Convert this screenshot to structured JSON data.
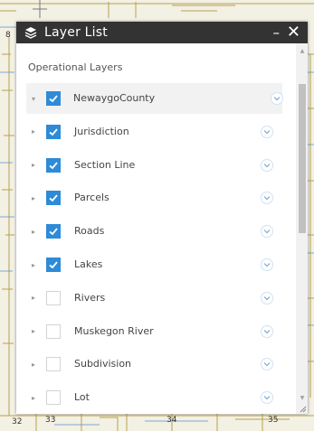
{
  "window": {
    "title": "Layer List",
    "minimize_glyph": "–",
    "close_glyph": "✕",
    "icon": "layers-icon"
  },
  "section_label": "Operational Layers",
  "layers": [
    {
      "label": "NewaygoCounty",
      "checked": true,
      "level": 0
    },
    {
      "label": "Jurisdiction",
      "checked": true,
      "level": 1
    },
    {
      "label": "Section Line",
      "checked": true,
      "level": 1
    },
    {
      "label": "Parcels",
      "checked": true,
      "level": 1
    },
    {
      "label": "Roads",
      "checked": true,
      "level": 1
    },
    {
      "label": "Lakes",
      "checked": true,
      "level": 1
    },
    {
      "label": "Rivers",
      "checked": false,
      "level": 1
    },
    {
      "label": "Muskegon River",
      "checked": false,
      "level": 1
    },
    {
      "label": "Subdivision",
      "checked": false,
      "level": 1
    },
    {
      "label": "Lot",
      "checked": false,
      "level": 1
    }
  ],
  "map_labels": {
    "l32": "32",
    "l33": "33",
    "l34": "34",
    "l35": "35",
    "l8": "8"
  },
  "colors": {
    "titlebar": "#333333",
    "checkbox_checked": "#2d8bd7",
    "root_row_bg": "#f2f2f2",
    "map_bg": "#f3f0e4",
    "map_lines": "#b5a24f"
  }
}
